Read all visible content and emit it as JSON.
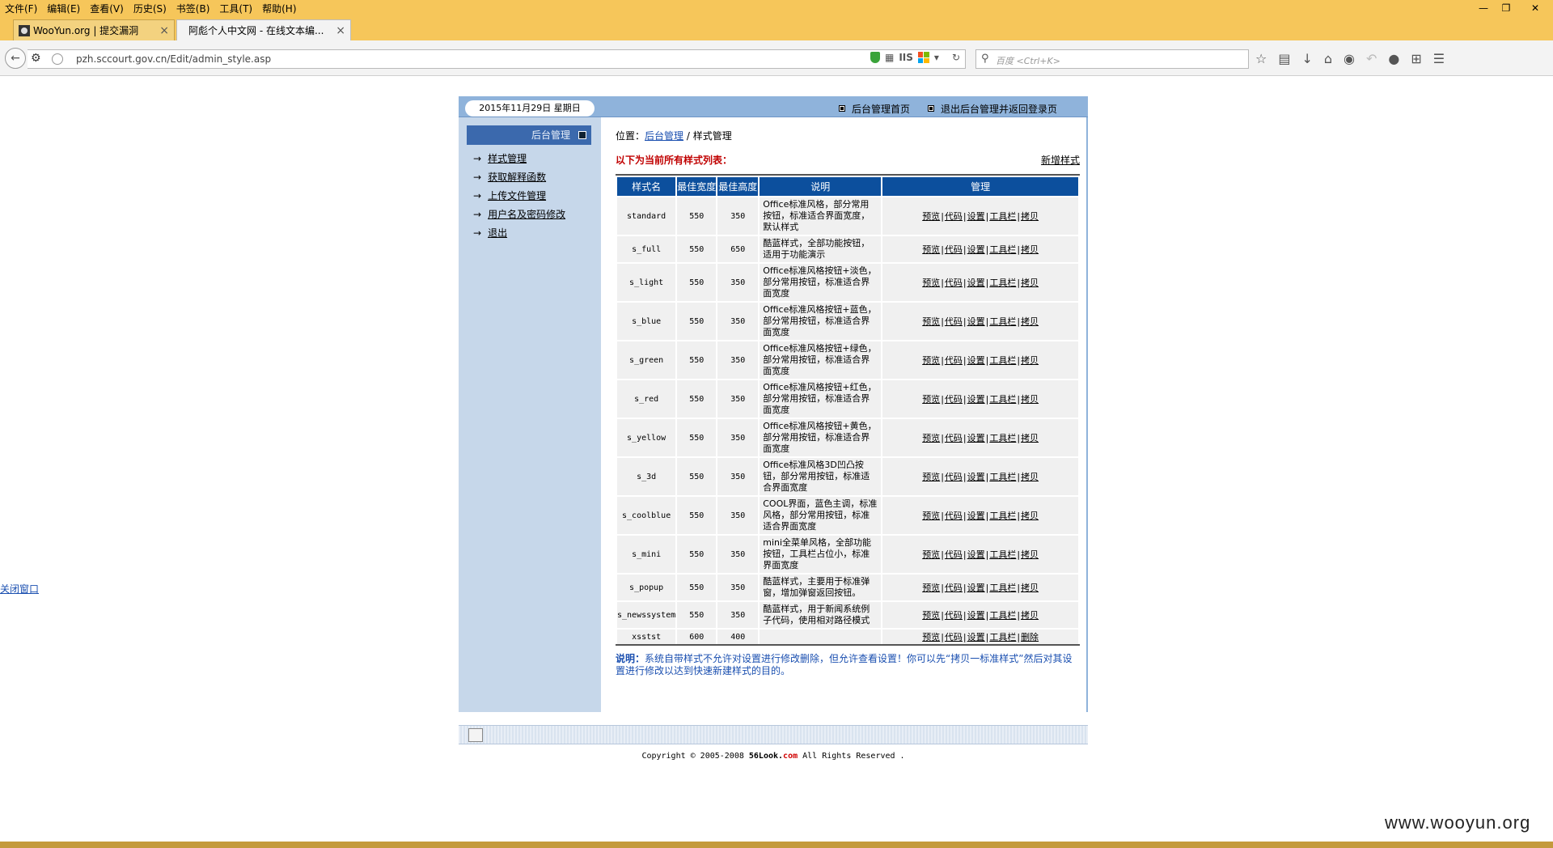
{
  "browser": {
    "menu": [
      "文件(F)",
      "编辑(E)",
      "查看(V)",
      "历史(S)",
      "书签(B)",
      "工具(T)",
      "帮助(H)"
    ],
    "tabs": [
      {
        "title": "WooYun.org | 提交漏洞"
      },
      {
        "title": "阿彪个人中文网 - 在线文本编..."
      }
    ],
    "url": "pzh.sccourt.gov.cn/Edit/admin_style.asp",
    "url_badge": "IIS",
    "search_placeholder": "百度 <Ctrl+K>"
  },
  "header": {
    "date": "2015年11月29日  星期日",
    "links": [
      "后台管理首页",
      "退出后台管理并返回登录页"
    ]
  },
  "sidebar": {
    "title": "后台管理",
    "items": [
      "样式管理",
      "获取解释函数",
      "上传文件管理",
      "用户名及密码修改",
      "退出"
    ]
  },
  "content": {
    "crumb_prefix": "位置：",
    "crumb_link": "后台管理",
    "crumb_sep": " / ",
    "crumb_current": "样式管理",
    "list_title": "以下为当前所有样式列表：",
    "new_style": "新增样式",
    "table": {
      "headers": [
        "样式名",
        "最佳宽度",
        "最佳高度",
        "说明",
        "管理"
      ],
      "rows": [
        {
          "name": "standard",
          "w": "550",
          "h": "350",
          "desc": "Office标准风格，部分常用按钮，标准适合界面宽度，默认样式",
          "last": "拷贝"
        },
        {
          "name": "s_full",
          "w": "550",
          "h": "650",
          "desc": "酷蓝样式，全部功能按钮，适用于功能演示",
          "last": "拷贝"
        },
        {
          "name": "s_light",
          "w": "550",
          "h": "350",
          "desc": "Office标准风格按钮+淡色，部分常用按钮，标准适合界面宽度",
          "last": "拷贝"
        },
        {
          "name": "s_blue",
          "w": "550",
          "h": "350",
          "desc": "Office标准风格按钮+蓝色，部分常用按钮，标准适合界面宽度",
          "last": "拷贝"
        },
        {
          "name": "s_green",
          "w": "550",
          "h": "350",
          "desc": "Office标准风格按钮+绿色，部分常用按钮，标准适合界面宽度",
          "last": "拷贝"
        },
        {
          "name": "s_red",
          "w": "550",
          "h": "350",
          "desc": "Office标准风格按钮+红色，部分常用按钮，标准适合界面宽度",
          "last": "拷贝"
        },
        {
          "name": "s_yellow",
          "w": "550",
          "h": "350",
          "desc": "Office标准风格按钮+黄色，部分常用按钮，标准适合界面宽度",
          "last": "拷贝"
        },
        {
          "name": "s_3d",
          "w": "550",
          "h": "350",
          "desc": "Office标准风格3D凹凸按钮，部分常用按钮，标准适合界面宽度",
          "last": "拷贝"
        },
        {
          "name": "s_coolblue",
          "w": "550",
          "h": "350",
          "desc": "COOL界面，蓝色主调，标准风格，部分常用按钮，标准适合界面宽度",
          "last": "拷贝"
        },
        {
          "name": "s_mini",
          "w": "550",
          "h": "350",
          "desc": "mini全菜单风格，全部功能按钮，工具栏占位小，标准界面宽度",
          "last": "拷贝"
        },
        {
          "name": "s_popup",
          "w": "550",
          "h": "350",
          "desc": "酷蓝样式，主要用于标准弹窗，增加弹窗返回按钮。",
          "last": "拷贝"
        },
        {
          "name": "s_newssystem",
          "w": "550",
          "h": "350",
          "desc": "酷蓝样式，用于新闻系统例子代码，使用相对路径模式",
          "last": "拷贝"
        },
        {
          "name": "xsstst",
          "w": "600",
          "h": "400",
          "desc": "",
          "last": "删除"
        }
      ],
      "actions": [
        "预览",
        "代码",
        "设置",
        "工具栏"
      ]
    },
    "note_label": "说明：",
    "note_text": "系统自带样式不允许对设置进行修改删除，但允许查看设置！你可以先“拷贝一标准样式”然后对其设置进行修改以达到快速新建样式的目的。"
  },
  "close_window": "关闭窗口",
  "footer": {
    "pre": "Copyright © 2005-2008 ",
    "brand": "56Look.",
    "brand_tld": "com",
    "post": " All Rights Reserved ."
  },
  "watermark": "www.wooyun.org"
}
